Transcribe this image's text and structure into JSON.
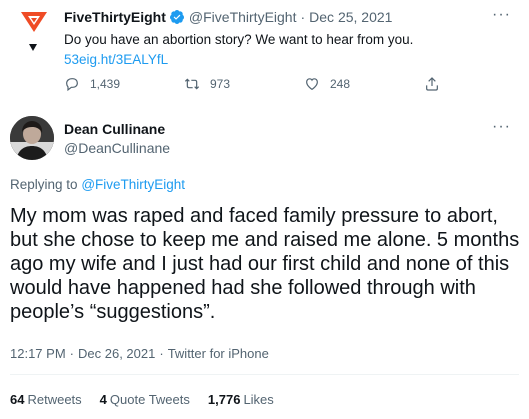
{
  "parent_tweet": {
    "author_name": "FiveThirtyEight",
    "author_handle": "@FiveThirtyEight",
    "separator": "·",
    "date": "Dec 25, 2021",
    "text": "Do you have an abortion story? We want to hear from you.",
    "link": "53eig.ht/3EALYfL",
    "more": "···",
    "stats": {
      "replies": "1,439",
      "retweets": "973",
      "likes": "248"
    },
    "icons": {
      "reply": "reply-icon",
      "retweet": "retweet-icon",
      "like": "heart-icon",
      "share": "share-icon",
      "verified": "verified-badge-icon",
      "logo": "fivethirtyeight-fox-logo"
    },
    "colors": {
      "logo": "#ef4b25",
      "verified": "#1d9bf0",
      "link": "#1d9bf0"
    }
  },
  "main_tweet": {
    "author_name": "Dean Cullinane",
    "author_handle": "@DeanCullinane",
    "more": "···",
    "replying_prefix": "Replying to",
    "replying_to": "@FiveThirtyEight",
    "text": "My mom was raped and faced family pressure to abort, but she chose to keep me and raised me alone. 5 months ago my wife and I just had our first child and none of this would have happened had she followed through with people’s “suggestions”.",
    "time": "12:17 PM",
    "separator": "·",
    "date": "Dec 26, 2021",
    "source": "Twitter for iPhone",
    "stats": {
      "retweets_count": "64",
      "retweets_label": "Retweets",
      "quotes_count": "4",
      "quotes_label": "Quote Tweets",
      "likes_count": "1,776",
      "likes_label": "Likes"
    }
  }
}
